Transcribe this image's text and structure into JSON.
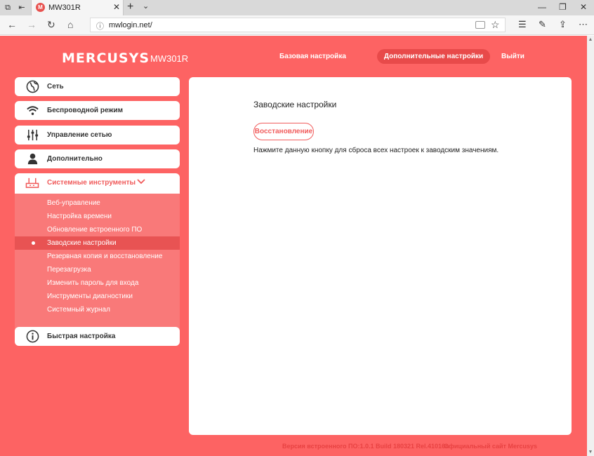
{
  "browser": {
    "tab_title": "MW301R",
    "favicon_letter": "M",
    "url": "mwlogin.net/"
  },
  "header": {
    "logo": "MERCUSYS",
    "model": "MW301R",
    "nav_basic": "Базовая настройка",
    "nav_advanced": "Дополнительные настройки",
    "nav_logout": "Выйти"
  },
  "sidebar": {
    "network": "Сеть",
    "wireless": "Беспроводной режим",
    "network_control": "Управление сетью",
    "advanced": "Дополнительно",
    "system_tools": "Системные инструменты",
    "quick_setup": "Быстрая настройка",
    "submenu": [
      "Веб-управление",
      "Настройка времени",
      "Обновление встроенного ПО",
      "Заводские настройки",
      "Резервная копия и восстановление",
      "Перезагрузка",
      "Изменить пароль для входа",
      "Инструменты диагностики",
      "Системный журнал"
    ]
  },
  "content": {
    "title": "Заводские настройки",
    "restore_button": "Восстановление",
    "description": "Нажмите данную кнопку для сброса всех настроек к заводским значениям."
  },
  "footer": {
    "firmware": "Версия встроенного ПО:1.0.1 Build 180321 Rel.41016n",
    "website": "Официальный сайт Mercusys"
  },
  "colors": {
    "page_bg": "#fd6363",
    "accent": "#f05a5a",
    "pill": "#e84a4a"
  }
}
